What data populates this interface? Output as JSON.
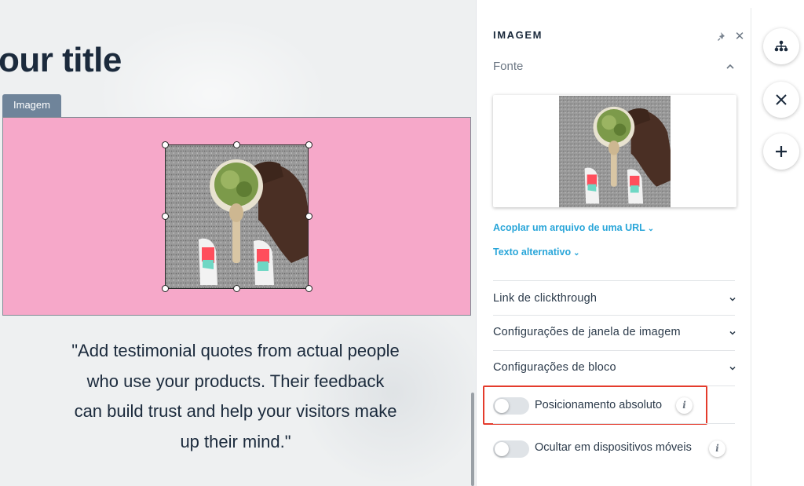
{
  "canvas": {
    "page_title": "our title",
    "image_tag": "Imagem",
    "quote": "\"Add testimonial quotes from actual people who use your products. Their feedback can build trust and help your visitors make up their mind.\"",
    "block_color": "#f6a8c9"
  },
  "panel": {
    "title": "IMAGEM",
    "section": "Fonte",
    "link_attach_url": "Acoplar um arquivo de uma URL",
    "link_alt_text": "Texto alternativo",
    "rows": [
      {
        "label": "Link de clickthrough"
      },
      {
        "label": "Configurações de janela de imagem"
      },
      {
        "label": "Configurações de bloco"
      }
    ],
    "toggles": [
      {
        "label": "Posicionamento absoluto",
        "on": false
      },
      {
        "label": "Ocultar em dispositivos móveis",
        "on": false
      }
    ],
    "accent_color": "#2aa6d9",
    "highlight_color": "#e43b2c"
  },
  "rail": {
    "icons": [
      "hierarchy-icon",
      "close-icon",
      "plus-icon"
    ]
  }
}
